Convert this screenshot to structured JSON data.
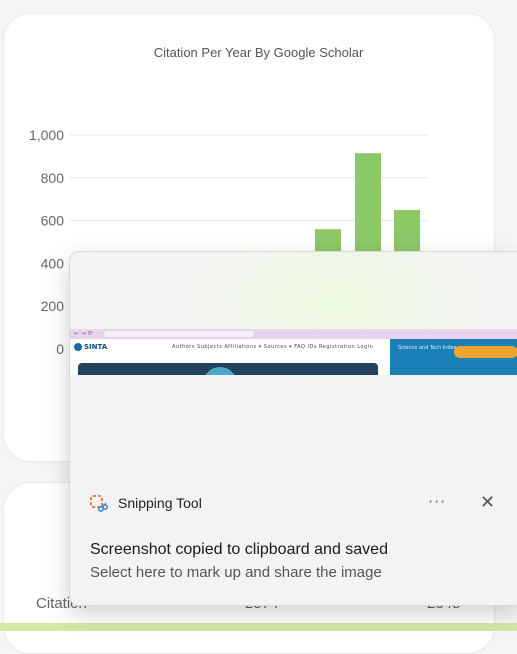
{
  "chart_data": {
    "type": "bar",
    "title": "Citation Per Year By Google Scholar",
    "y_ticks": [
      "0",
      "200",
      "400",
      "600",
      "800",
      "1,000"
    ],
    "ylim": [
      0,
      1000
    ],
    "grid": true,
    "color": "#8cc866",
    "values": [
      560,
      915,
      650
    ]
  },
  "stats": {
    "row_label": "Citation",
    "col1": "2574",
    "col2": "2348"
  },
  "notification": {
    "app_name": "Snipping Tool",
    "more_label": "···",
    "close_label": "✕",
    "heading": "Screenshot copied to clipboard and saved",
    "body": "Select here to mark up and share the image",
    "preview": {
      "logo": "SINTA",
      "menu": "Authors   Subjects   Affiliations ▾   Sources ▾   FAQ   IDs   Registration   Login",
      "side_text": "Science and Tech Index"
    }
  },
  "colors": {
    "accent_green": "#8cc866",
    "strip": "#d4e9a6"
  }
}
